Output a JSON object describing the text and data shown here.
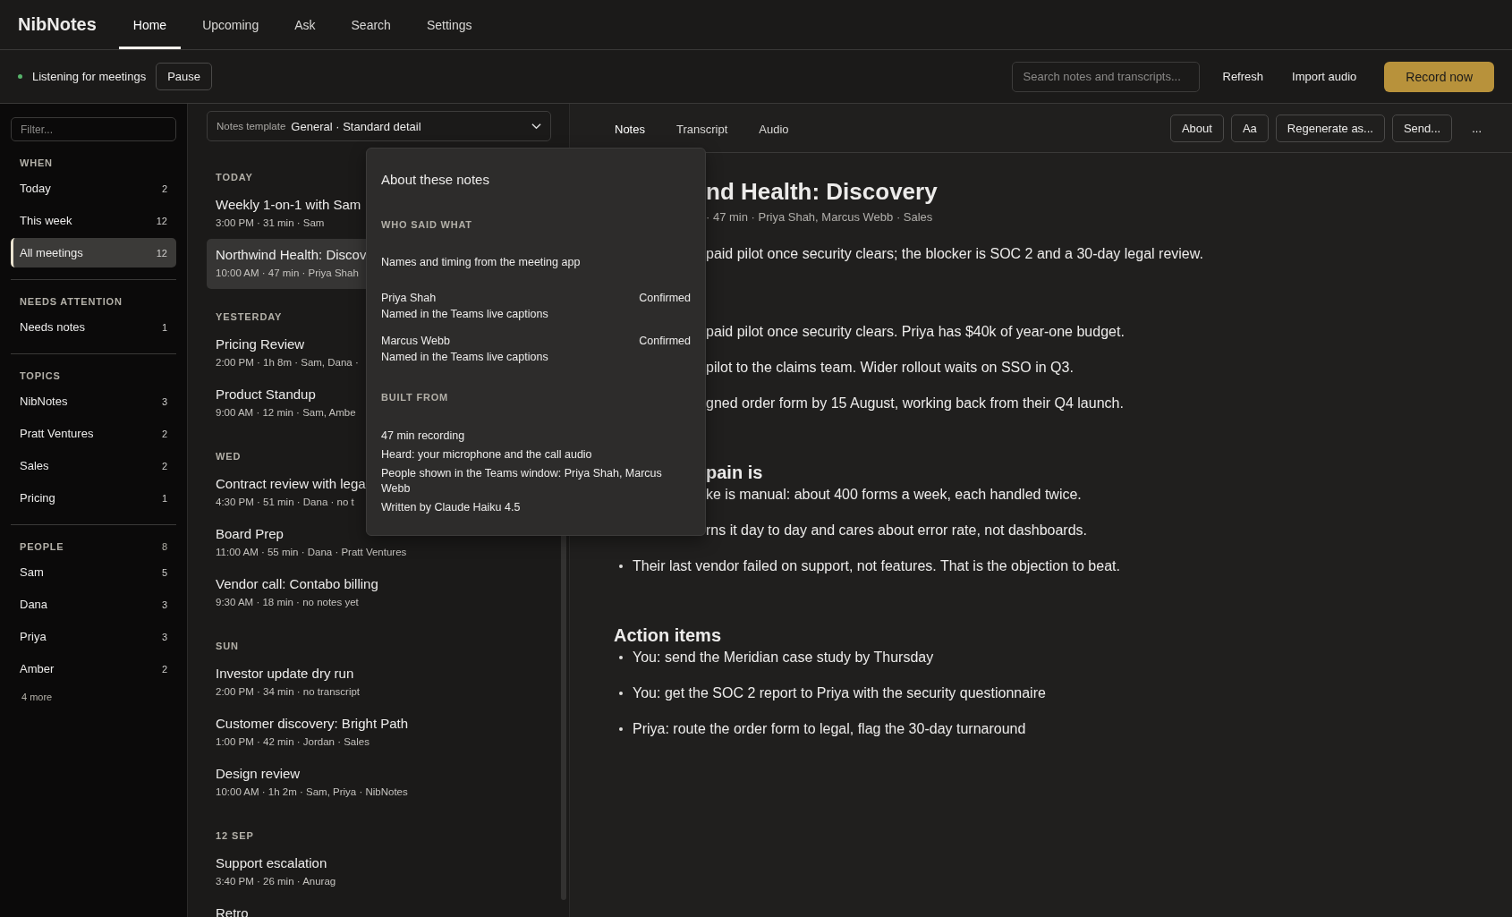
{
  "app": {
    "name": "NibNotes"
  },
  "nav_tabs": [
    {
      "label": "Home",
      "selected": true
    },
    {
      "label": "Upcoming",
      "selected": false
    },
    {
      "label": "Ask",
      "selected": false
    },
    {
      "label": "Search",
      "selected": false
    },
    {
      "label": "Settings",
      "selected": false
    }
  ],
  "status": {
    "listening": true,
    "text": "Listening for meetings",
    "pause_button": "Pause"
  },
  "search": {
    "placeholder": "Search notes and transcripts..."
  },
  "actions": [
    "Refresh",
    "Import audio"
  ],
  "record_button": "Record now",
  "sidebar": {
    "filter_placeholder": "Filter...",
    "sections": [
      {
        "title": "WHEN",
        "items": [
          {
            "label": "Today",
            "count": "2",
            "selected": false
          },
          {
            "label": "This week",
            "count": "12",
            "selected": false
          },
          {
            "label": "All meetings",
            "count": "12",
            "selected": true
          }
        ]
      },
      {
        "title": "NEEDS ATTENTION",
        "items": [
          {
            "label": "Needs notes",
            "count": "1",
            "selected": false
          }
        ]
      },
      {
        "title": "TOPICS",
        "items": [
          {
            "label": "NibNotes",
            "count": "3",
            "selected": false
          },
          {
            "label": "Pratt Ventures",
            "count": "2",
            "selected": false
          },
          {
            "label": "Sales",
            "count": "2",
            "selected": false
          },
          {
            "label": "Pricing",
            "count": "1",
            "selected": false
          }
        ]
      },
      {
        "title": "PEOPLE",
        "count": "8",
        "items": [
          {
            "label": "Sam",
            "count": "5",
            "selected": false
          },
          {
            "label": "Dana",
            "count": "3",
            "selected": false
          },
          {
            "label": "Priya",
            "count": "3",
            "selected": false
          },
          {
            "label": "Amber",
            "count": "2",
            "selected": false
          }
        ],
        "more": "4 more"
      }
    ]
  },
  "template": {
    "label": "Notes template",
    "value": "General · Standard detail"
  },
  "meetings": [
    {
      "group": "TODAY",
      "items": [
        {
          "title": "Weekly 1-on-1 with Sam",
          "meta": "3:00 PM · 31 min · Sam",
          "selected": false
        },
        {
          "title": "Northwind Health: Discov",
          "meta": "10:00 AM · 47 min · Priya Shah",
          "selected": true
        }
      ]
    },
    {
      "group": "YESTERDAY",
      "items": [
        {
          "title": "Pricing Review",
          "meta": "2:00 PM · 1h 8m · Sam, Dana ·",
          "selected": false
        },
        {
          "title": "Product Standup",
          "meta": "9:00 AM · 12 min · Sam, Ambe",
          "selected": false
        }
      ]
    },
    {
      "group": "WED",
      "items": [
        {
          "title": "Contract review with lega",
          "meta": "4:30 PM · 51 min · Dana · no t",
          "selected": false
        },
        {
          "title": "Board Prep",
          "meta": "11:00 AM · 55 min · Dana · Pratt Ventures",
          "selected": false
        },
        {
          "title": "Vendor call: Contabo billing",
          "meta": "9:30 AM · 18 min · no notes yet",
          "selected": false
        }
      ]
    },
    {
      "group": "SUN",
      "items": [
        {
          "title": "Investor update dry run",
          "meta": "2:00 PM · 34 min · no transcript",
          "selected": false
        },
        {
          "title": "Customer discovery: Bright Path",
          "meta": "1:00 PM · 42 min · Jordan · Sales",
          "selected": false
        },
        {
          "title": "Design review",
          "meta": "10:00 AM · 1h 2m · Sam, Priya · NibNotes",
          "selected": false
        }
      ]
    },
    {
      "group": "12 SEP",
      "items": [
        {
          "title": "Support escalation",
          "meta": "3:40 PM · 26 min · Anurag",
          "selected": false
        },
        {
          "title": "Retro",
          "selected": false
        }
      ]
    }
  ],
  "note_tabs": [
    {
      "label": "Notes",
      "selected": true
    },
    {
      "label": "Transcript",
      "selected": false
    },
    {
      "label": "Audio",
      "selected": false
    }
  ],
  "note_buttons": [
    "About",
    "Aa",
    "Regenerate as...",
    "Send...",
    "..."
  ],
  "note": {
    "title": {
      "text": "nd Health: Discovery",
      "covered": true
    },
    "meta": {
      "text": "· 47 min · Priya Shah, Marcus Webb · Sales",
      "covered": true
    },
    "summary": {
      "text": "paid pilot once security clears; the blocker is SOC 2 and a 30-day legal review.",
      "covered": true
    },
    "sections": [
      {
        "items": [
          {
            "text": "paid pilot once security clears. Priya has $40k of year-one budget.",
            "covered": true
          },
          {
            "text": "pilot to the claims team. Wider rollout waits on SSO in Q3.",
            "covered": true
          },
          {
            "text": "gned order form by 15 August, working back from their Q4 launch.",
            "covered": true
          }
        ]
      },
      {
        "heading": "pain is",
        "items": [
          {
            "text": "ke is manual: about 400 forms a week, each handled twice.",
            "covered": true
          },
          {
            "text": "rns it day to day and cares about error rate, not dashboards.",
            "covered": true
          },
          {
            "text": "Their last vendor failed on support, not features. That is the objection to beat.",
            "covered": false
          }
        ]
      },
      {
        "heading": "Action items",
        "items": [
          {
            "text": "You: send the Meridian case study by Thursday",
            "covered": false
          },
          {
            "text": "You: get the SOC 2 report to Priya with the security questionnaire",
            "covered": false
          },
          {
            "text": "Priya: route the order form to legal, flag the 30-day turnaround",
            "covered": false
          }
        ]
      }
    ]
  },
  "popover": {
    "title": "About these notes",
    "sections": [
      {
        "heading": "WHO SAID WHAT",
        "intro": "Names and timing from the meeting app",
        "people": [
          {
            "name": "Priya Shah",
            "status": "Confirmed",
            "source": "Named in the Teams live captions"
          },
          {
            "name": "Marcus Webb",
            "status": "Confirmed",
            "source": "Named in the Teams live captions"
          }
        ]
      },
      {
        "heading": "BUILT FROM",
        "lines": [
          "47 min recording",
          "Heard: your microphone and the call audio",
          "People shown in the Teams window: Priya Shah, Marcus Webb",
          "Written by Claude Haiku 4.5"
        ]
      }
    ]
  }
}
